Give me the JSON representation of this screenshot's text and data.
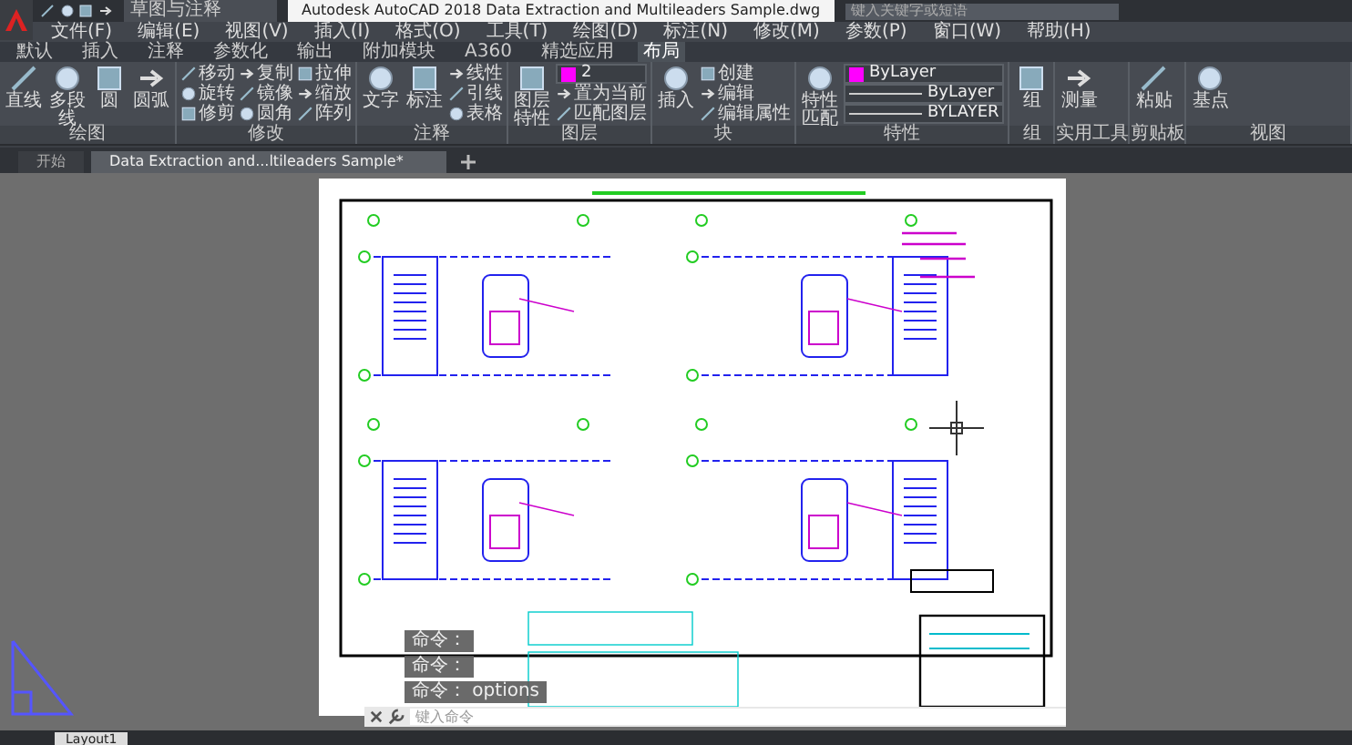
{
  "title_bar": {
    "workspace": "草图与注释",
    "title": "Autodesk AutoCAD 2018    Data Extraction and Multileaders Sample.dwg",
    "search_placeholder": "键入关键字或短语"
  },
  "menu": [
    "文件(F)",
    "编辑(E)",
    "视图(V)",
    "插入(I)",
    "格式(O)",
    "工具(T)",
    "绘图(D)",
    "标注(N)",
    "修改(M)",
    "参数(P)",
    "窗口(W)",
    "帮助(H)"
  ],
  "ribbon_tabs": [
    {
      "label": "默认",
      "selected": false
    },
    {
      "label": "插入",
      "selected": false
    },
    {
      "label": "注释",
      "selected": false
    },
    {
      "label": "参数化",
      "selected": false
    },
    {
      "label": "输出",
      "selected": false
    },
    {
      "label": "附加模块",
      "selected": false
    },
    {
      "label": "A360",
      "selected": false
    },
    {
      "label": "精选应用",
      "selected": false
    },
    {
      "label": "布局",
      "selected": true
    }
  ],
  "panels": [
    {
      "title": "绘图",
      "large": [
        "直线",
        "多段线",
        "圆",
        "圆弧"
      ]
    },
    {
      "title": "修改",
      "small": [
        "移动",
        "旋转",
        "修剪",
        "复制",
        "镜像",
        "圆角",
        "拉伸",
        "缩放",
        "阵列"
      ]
    },
    {
      "title": "注释",
      "large": [
        "文字",
        "标注"
      ],
      "small": [
        "线性",
        "引线",
        "表格"
      ]
    },
    {
      "title": "图层",
      "large": [
        "图层特性"
      ],
      "dropdowns": [
        {
          "value": "2",
          "color": "#ff00ff"
        }
      ],
      "small": [
        "置为当前",
        "匹配图层"
      ]
    },
    {
      "title": "块",
      "large": [
        "插入"
      ],
      "small": [
        "创建",
        "编辑",
        "编辑属性"
      ]
    },
    {
      "title": "特性",
      "large": [
        "特性匹配"
      ],
      "dropdowns": [
        {
          "value": "ByLayer",
          "color": "#ff00ff"
        },
        {
          "value": "ByLayer"
        },
        {
          "value": "BYLAYER"
        }
      ]
    },
    {
      "title": "组",
      "large": [
        "组"
      ]
    },
    {
      "title": "实用工具",
      "large": [
        "测量"
      ]
    },
    {
      "title": "剪贴板",
      "large": [
        "粘贴"
      ]
    },
    {
      "title": "视图",
      "large": [
        "基点"
      ]
    }
  ],
  "document_tabs": [
    {
      "label": "开始",
      "selected": false
    },
    {
      "label": "Data Extraction and...ltileaders Sample*",
      "selected": true
    }
  ],
  "command_history": [
    "命令：",
    "命令：",
    "命令：  options"
  ],
  "command_input": {
    "placeholder": "键入命令"
  },
  "layout_tabs": [
    {
      "label": "Layout1",
      "selected": true
    }
  ]
}
